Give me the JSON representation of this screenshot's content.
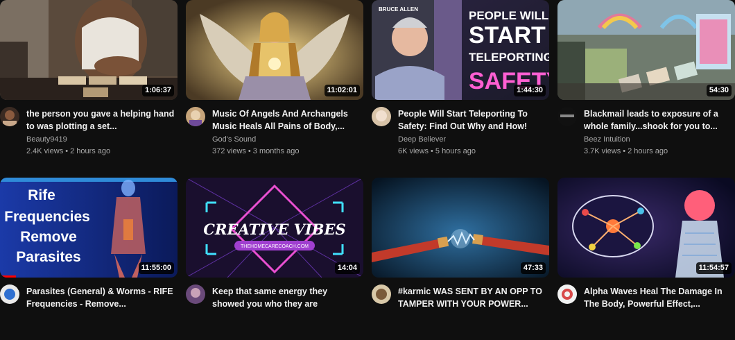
{
  "videos": [
    {
      "title": "the person you gave a helping hand to was plotting a set...",
      "channel": "Beauty9419",
      "views": "2.4K views",
      "age": "2 hours ago",
      "duration": "1:06:37"
    },
    {
      "title": "Music Of Angels And Archangels Music Heals All Pains of Body,...",
      "channel": "God's Sound",
      "views": "372 views",
      "age": "3 months ago",
      "duration": "11:02:01"
    },
    {
      "title": "People Will Start Teleporting To Safety: Find Out Why and How!",
      "channel": "Deep Believer",
      "views": "6K views",
      "age": "5 hours ago",
      "duration": "1:44:30",
      "thumb_text": {
        "name": "BRUCE ALLEN",
        "line1": "PEOPLE WILL",
        "line2": "START",
        "line3": "TELEPORTING",
        "line4": "SAFETY"
      }
    },
    {
      "title": "Blackmail leads to exposure of a whole family...shook for you to...",
      "channel": "Beez Intuition",
      "views": "3.7K views",
      "age": "2 hours ago",
      "duration": "54:30"
    },
    {
      "title": "Parasites (General) & Worms - RIFE Frequencies - Remove...",
      "channel": "",
      "views": "",
      "age": "",
      "duration": "11:55:00",
      "progress": 0.09,
      "thumb_text": {
        "line1": "Rife",
        "line2": "Frequencies",
        "line3": "Remove",
        "line4": "Parasites"
      }
    },
    {
      "title": "Keep that same energy they showed you who they are",
      "channel": "",
      "views": "",
      "age": "",
      "duration": "14:04",
      "thumb_text": {
        "line1": "CREATIVE VIBES",
        "line2": "THEHOMECARECOACH.COM"
      }
    },
    {
      "title": "#karmic WAS SENT BY AN OPP TO TAMPER WITH YOUR POWER...",
      "channel": "",
      "views": "",
      "age": "",
      "duration": "47:33"
    },
    {
      "title": "Alpha Waves Heal The Damage In The Body, Powerful Effect,...",
      "channel": "",
      "views": "",
      "age": "",
      "duration": "11:54:57"
    }
  ],
  "separator": "•"
}
